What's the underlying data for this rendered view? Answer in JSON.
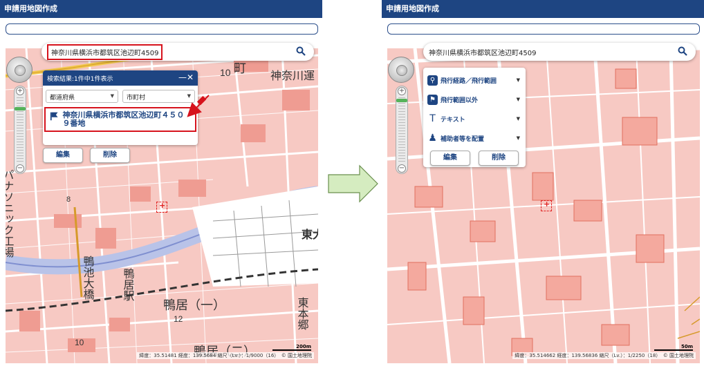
{
  "left": {
    "title": "申請用地図作成",
    "search": {
      "value": "神奈川県横浜市都筑区池辺町4509"
    },
    "result_panel": {
      "header": "検索結果:1件中1件表示",
      "close_glyph": "—✕",
      "prefecture_select": "都道府県",
      "city_select": "市町村",
      "result_item": "神奈川県横浜市都筑区池辺町４５０９番地"
    },
    "actions": {
      "edit": "編集",
      "delete": "削除"
    },
    "map_labels": [
      "10",
      "町",
      "神奈川運",
      "パナソニック工場",
      "8",
      "鴨池大橋",
      "鴨居駅",
      "鴨居（一）",
      "12",
      "東本郷",
      "10",
      "鴨居（二）",
      "東大"
    ],
    "scale": "200m",
    "coords": "緯度：35.51481 経度：139.5684 縮尺（Lv.）：1/9000（16）　© 国土地理院"
  },
  "right": {
    "title": "申請用地図作成",
    "search": {
      "value": "神奈川県横浜市都筑区池辺町4509"
    },
    "tools": [
      {
        "label": "飛行経路／飛行範囲",
        "icon": "person-pin-icon"
      },
      {
        "label": "飛行範囲以外",
        "icon": "area-pin-icon"
      },
      {
        "label": "テキスト",
        "icon": "text-icon"
      },
      {
        "label": "補助者等を配置",
        "icon": "person-icon"
      }
    ],
    "actions": {
      "edit": "編集",
      "delete": "削除"
    },
    "scale": "50m",
    "coords": "緯度：35.514662 経度：139.56836 縮尺（Lv.）：1/2250（18）　© 国土地理院"
  },
  "colors": {
    "header": "#1e4582",
    "highlight": "#d6121c",
    "map_bg": "#f7c9c3",
    "arrow": "#d5ecc0"
  }
}
